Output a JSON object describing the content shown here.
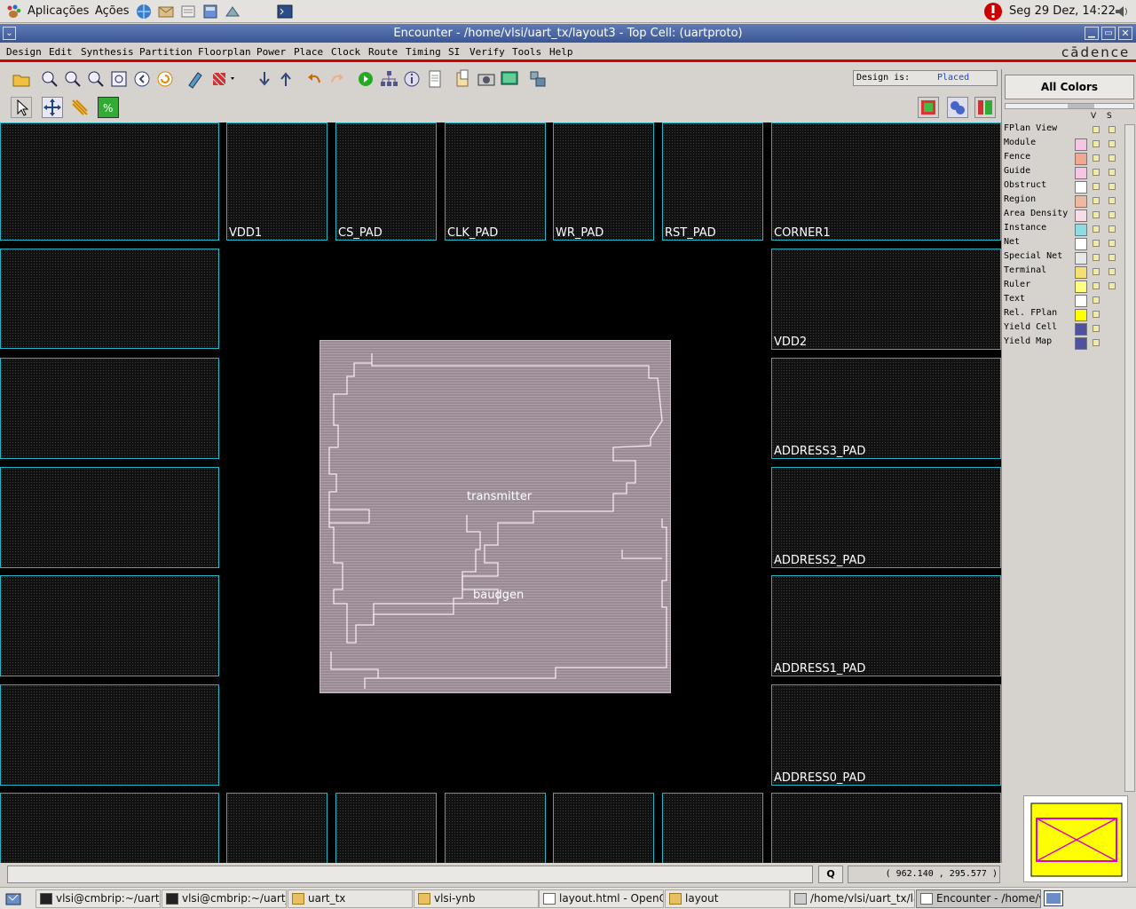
{
  "top_panel": {
    "apps_label": "Aplicações",
    "actions_label": "Ações",
    "clock": "Seg 29 Dez, 14:22"
  },
  "window": {
    "title": "Encounter - /home/vlsi/uart_tx/layout3 - Top Cell: (uartproto)"
  },
  "menu": [
    "Design",
    "Edit",
    "Synthesis",
    "Partition",
    "Floorplan",
    "Power",
    "Place",
    "Clock",
    "Route",
    "Timing",
    "SI",
    "Verify",
    "Tools",
    "Help"
  ],
  "brand": "cādence",
  "design_status": {
    "label": "Design is:",
    "value": "Placed"
  },
  "right_panel": {
    "all_colors_label": "All Colors",
    "col_v": "V",
    "col_s": "S",
    "legend": [
      {
        "name": "FPlan View",
        "color": "#d6d3ce"
      },
      {
        "name": "Module",
        "color": "#f4c6e4"
      },
      {
        "name": "Fence",
        "color": "#f0a890"
      },
      {
        "name": "Guide",
        "color": "#f4c6e4"
      },
      {
        "name": "Obstruct",
        "color": "#ffffff"
      },
      {
        "name": "Region",
        "color": "#f0b8a0"
      },
      {
        "name": "Area Density",
        "color": "#f8dce8"
      },
      {
        "name": "Instance",
        "color": "#8cdce4"
      },
      {
        "name": "Net",
        "color": "#ffffff"
      },
      {
        "name": "Special Net",
        "color": "#e8e8e8"
      },
      {
        "name": "Terminal",
        "color": "#f4e070"
      },
      {
        "name": "Ruler",
        "color": "#ffff80"
      },
      {
        "name": "Text",
        "color": "#ffffff"
      },
      {
        "name": "Rel. FPlan",
        "color": "#ffff00"
      },
      {
        "name": "Yield Cell",
        "color": "#5050a0"
      },
      {
        "name": "Yield Map",
        "color": "#5050a0"
      }
    ]
  },
  "pads": {
    "vdd1": "VDD1",
    "cs": "CS_PAD",
    "clk": "CLK_PAD",
    "wr": "WR_PAD",
    "rst": "RST_PAD",
    "corner1": "CORNER1",
    "vdd2": "VDD2",
    "addr3": "ADDRESS3_PAD",
    "addr2": "ADDRESS2_PAD",
    "addr1": "ADDRESS1_PAD",
    "addr0": "ADDRESS0_PAD"
  },
  "core": {
    "transmitter": "transmitter",
    "baudgen": "baudgen"
  },
  "status": {
    "q_button": "Q",
    "coords": "( 962.140 , 295.577 )"
  },
  "taskbar": [
    "vlsi@cmbrip:~/uart_",
    "vlsi@cmbrip:~/uart_",
    "uart_tx",
    "vlsi-ynb",
    "layout.html - OpenC",
    "layout",
    "/home/vlsi/uart_tx/la",
    "Encounter - /home/v"
  ]
}
